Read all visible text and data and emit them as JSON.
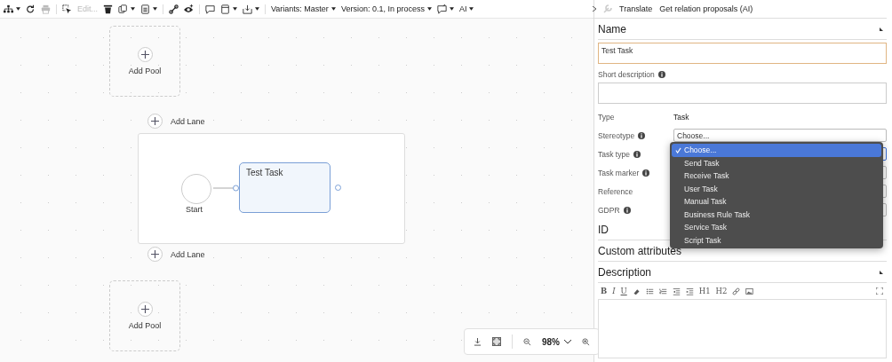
{
  "toolbar": [
    {
      "kind": "icon",
      "caret": true,
      "disabled": false
    },
    {
      "kind": "icon",
      "caret": false,
      "disabled": false
    },
    {
      "kind": "icon",
      "caret": false,
      "disabled": true
    },
    {
      "kind": "separator"
    },
    {
      "kind": "icon",
      "caret": false,
      "disabled": false
    },
    {
      "kind": "text",
      "label": "Edit...",
      "disabled": true
    },
    {
      "kind": "icon",
      "caret": false,
      "disabled": false
    },
    {
      "kind": "icon",
      "caret": true,
      "disabled": false
    },
    {
      "kind": "icon",
      "caret": true,
      "disabled": false
    },
    {
      "kind": "separator"
    },
    {
      "kind": "icon",
      "caret": false,
      "disabled": false
    },
    {
      "kind": "icon",
      "caret": false,
      "disabled": false
    },
    {
      "kind": "separator"
    },
    {
      "kind": "icon",
      "caret": false,
      "disabled": false
    },
    {
      "kind": "icon",
      "caret": true,
      "disabled": false
    },
    {
      "kind": "icon",
      "caret": true,
      "disabled": false
    },
    {
      "kind": "separator"
    },
    {
      "kind": "menu",
      "label": "Variants: Master"
    },
    {
      "kind": "menu",
      "label": "Version: 0.1, In process"
    },
    {
      "kind": "icon",
      "caret": true,
      "disabled": false
    },
    {
      "kind": "menu",
      "label": "AI"
    }
  ],
  "canvas": {
    "add_pool": [
      {
        "label": "Add Pool"
      },
      {
        "label": "Add Pool"
      }
    ],
    "add_lane": [
      {
        "label": "Add Lane"
      },
      {
        "label": "Add Lane"
      }
    ],
    "start_event": {
      "label": "Start"
    },
    "task": {
      "label": "Test Task",
      "selected": true
    },
    "zoom": {
      "value": "98%"
    }
  },
  "panel": {
    "actions": [
      {
        "kind": "icon",
        "disabled": true
      },
      {
        "kind": "text",
        "label": "Translate"
      },
      {
        "kind": "text",
        "label": "Get relation proposals (AI)"
      }
    ],
    "name": {
      "title": "Name",
      "value": "Test Task",
      "focused": true
    },
    "short_description": {
      "label": "Short description",
      "info": true
    },
    "rows": [
      {
        "kind": "text",
        "label": "Type",
        "info": false,
        "value": "Task"
      },
      {
        "kind": "select",
        "label": "Stereotype",
        "info": true,
        "value": "Choose...",
        "focused": false
      },
      {
        "kind": "select",
        "label": "Task type",
        "info": true,
        "focused": true
      },
      {
        "kind": "select",
        "label": "Task marker",
        "info": true,
        "focused": false
      },
      {
        "kind": "select",
        "label": "Reference",
        "info": false,
        "focused": false
      },
      {
        "kind": "select",
        "label": "GDPR",
        "info": true,
        "focused": false
      }
    ],
    "sections": [
      {
        "title": "ID"
      },
      {
        "title": "Custom attributes"
      }
    ],
    "description": {
      "title": "Description",
      "tools": [
        {
          "kind": "letter",
          "label": "B"
        },
        {
          "kind": "letter",
          "label": "I"
        },
        {
          "kind": "letter",
          "label": "U"
        },
        {
          "kind": "icon"
        },
        {
          "kind": "icon"
        },
        {
          "kind": "icon"
        },
        {
          "kind": "icon"
        },
        {
          "kind": "icon"
        },
        {
          "kind": "letter",
          "label": "H1"
        },
        {
          "kind": "letter",
          "label": "H2"
        },
        {
          "kind": "icon"
        },
        {
          "kind": "icon"
        }
      ]
    }
  },
  "dropdown": [
    {
      "label": "Choose...",
      "selected": true
    },
    {
      "label": "Send Task",
      "selected": false
    },
    {
      "label": "Receive Task",
      "selected": false
    },
    {
      "label": "User Task",
      "selected": false
    },
    {
      "label": "Manual Task",
      "selected": false
    },
    {
      "label": "Business Rule Task",
      "selected": false
    },
    {
      "label": "Service Task",
      "selected": false
    },
    {
      "label": "Script Task",
      "selected": false
    }
  ]
}
